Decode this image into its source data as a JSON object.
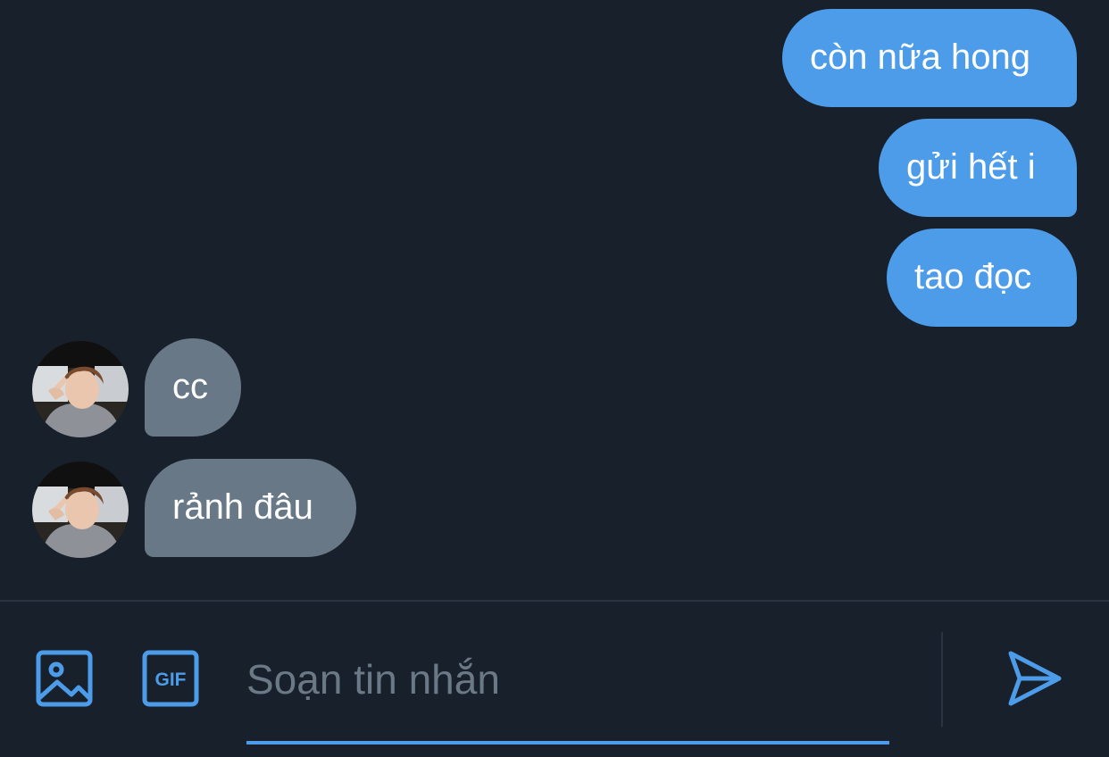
{
  "conversation": {
    "messages": [
      {
        "direction": "outgoing",
        "text": "còn nữa hong"
      },
      {
        "direction": "outgoing",
        "text": "gửi hết i"
      },
      {
        "direction": "outgoing",
        "text": "tao đọc"
      },
      {
        "direction": "incoming",
        "text": "cc"
      },
      {
        "direction": "incoming",
        "text": "rảnh đâu"
      }
    ]
  },
  "composer": {
    "placeholder": "Soạn tin nhắn",
    "value": "",
    "icons": {
      "image": "image-icon",
      "gif": "gif-icon",
      "send": "send-icon"
    },
    "gif_label": "GIF"
  },
  "colors": {
    "background": "#18202b",
    "outgoing_bubble": "#4c9ce9",
    "incoming_bubble": "#687887",
    "accent": "#4c9ce9",
    "placeholder": "#6b7885"
  }
}
